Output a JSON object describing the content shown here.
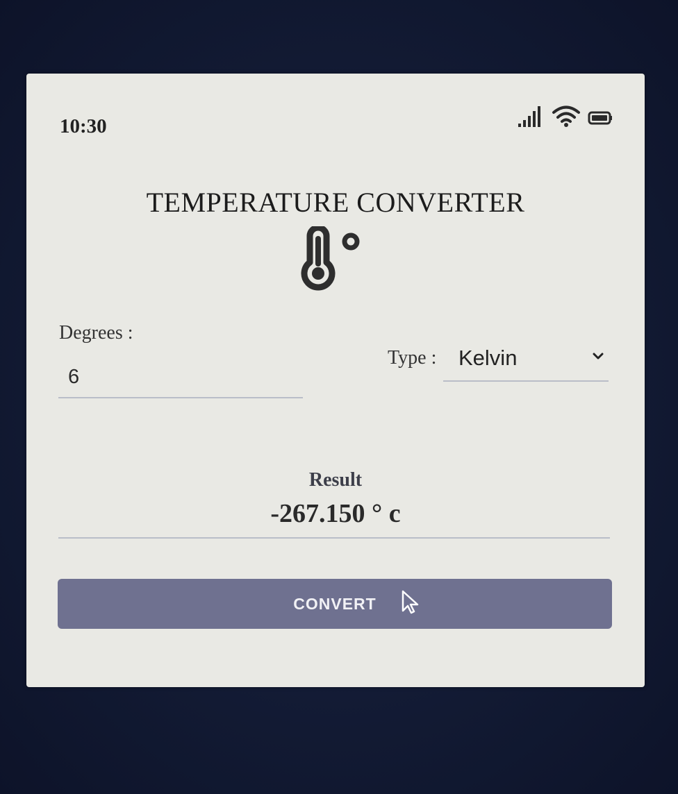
{
  "status_bar": {
    "time": "10:30",
    "icons": [
      "signal-icon",
      "wifi-icon",
      "battery-icon"
    ]
  },
  "header": {
    "title": "TEMPERATURE CONVERTER",
    "icon": "thermometer-icon"
  },
  "form": {
    "degrees_label": "Degrees :",
    "degrees_value": "6",
    "type_label": "Type :",
    "type_selected": "Kelvin"
  },
  "result": {
    "label": "Result",
    "value": "-267.150 ° c"
  },
  "actions": {
    "convert_label": "CONVERT"
  },
  "colors": {
    "button": "#6f7190",
    "card": "#e9e9e4",
    "background": "#121a33"
  }
}
